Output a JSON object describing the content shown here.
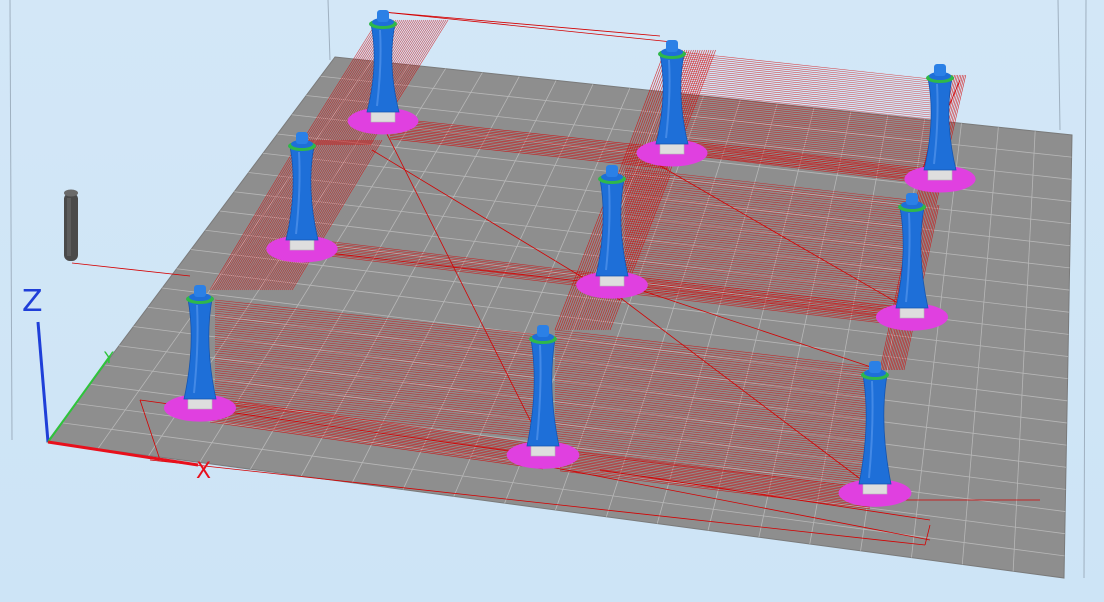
{
  "viewport": {
    "view": "3D preview",
    "background_color": "#cde4f6",
    "bed_color": "#8e8e8e",
    "grid_color": "#b7b7b7",
    "travel_color": "#d40000",
    "support_color": "#1e6fd8",
    "brim_color": "#e040e0",
    "base_color": "#dedede",
    "top_color": "#2fb84a",
    "bed_grid": {
      "columns": 20,
      "rows": 20
    },
    "pillar_count": 9,
    "nozzle_visible": true
  },
  "axes": {
    "x_label": "X",
    "y_label": "Y",
    "z_label": "Z",
    "x_color": "#e8101c",
    "y_color": "#2ec43a",
    "z_color": "#1f3fd8"
  }
}
